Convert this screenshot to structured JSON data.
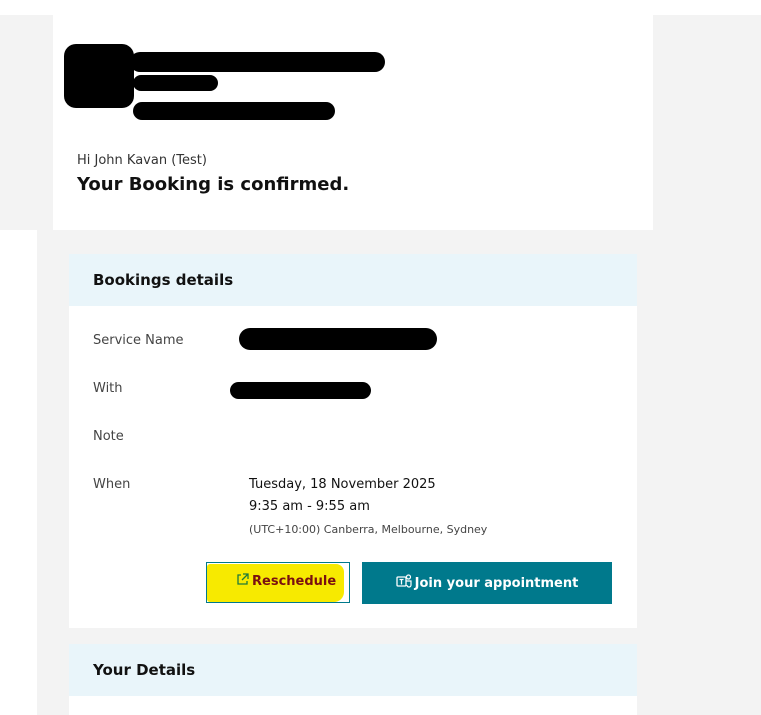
{
  "greeting": "Hi John Kavan (Test)",
  "headline": "Your Booking is confirmed.",
  "details": {
    "title": "Bookings details",
    "service_label": "Service Name",
    "with_label": "With",
    "note_label": "Note",
    "when_label": "When",
    "when_date": "Tuesday, 18 November 2025",
    "when_time": "9:35 am - 9:55 am",
    "when_tz": "(UTC+10:00) Canberra, Melbourne, Sydney"
  },
  "buttons": {
    "reschedule": "Reschedule",
    "join": "Join your appointment"
  },
  "your_details": {
    "title": "Your Details"
  },
  "icons": {
    "reschedule": "external-link-icon",
    "join": "teams-icon"
  },
  "colors": {
    "accent": "#00798c",
    "panel_header": "#e9f5fa",
    "highlight": "#f7ea00"
  }
}
